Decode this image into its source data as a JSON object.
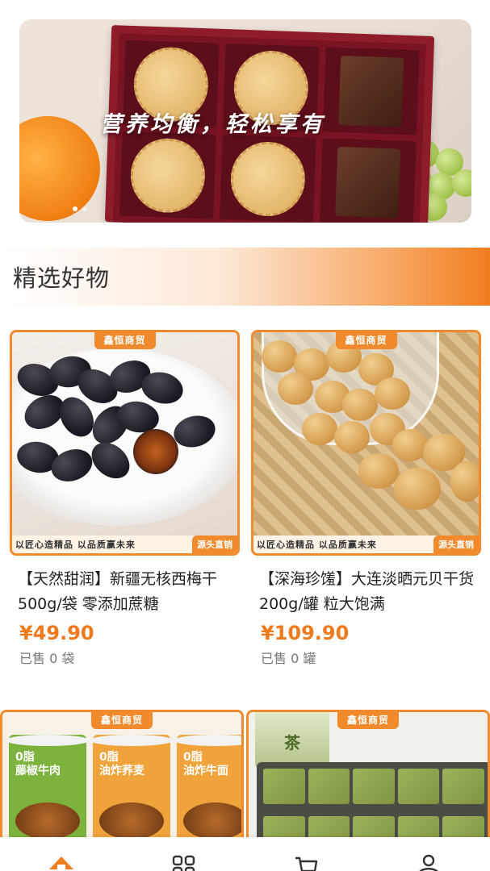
{
  "banner": {
    "slogan": "营养均衡，轻松享有"
  },
  "section": {
    "title": "精选好物"
  },
  "products": [
    {
      "brand_tag": "鑫恒商贸",
      "strip_slogan": "以匠心造精品  以品质赢未来",
      "strip_tag": "源头直销",
      "name": "【天然甜润】新疆无核西梅干 500g/袋 零添加蔗糖",
      "price": "¥49.90",
      "sold": "已售 0 袋"
    },
    {
      "brand_tag": "鑫恒商贸",
      "strip_slogan": "以匠心造精品  以品质赢未来",
      "strip_tag": "源头直销",
      "name": "【深海珍馐】大连淡晒元贝干货 200g/罐 粒大饱满",
      "price": "¥109.90",
      "sold": "已售 0 罐"
    },
    {
      "brand_tag": "鑫恒商贸",
      "cup_labels": [
        "0脂\n藤椒牛肉",
        "0脂\n油炸荞麦",
        "0脂\n油炸牛面"
      ]
    },
    {
      "brand_tag": "鑫恒商贸",
      "tin_label": "茶"
    }
  ],
  "nav": {
    "active": "home",
    "items": [
      {
        "icon": "home-icon"
      },
      {
        "icon": "category-icon"
      },
      {
        "icon": "cart-icon"
      },
      {
        "icon": "profile-icon"
      }
    ]
  },
  "colors": {
    "accent": "#f08a2c",
    "price": "#ee7a1d"
  }
}
